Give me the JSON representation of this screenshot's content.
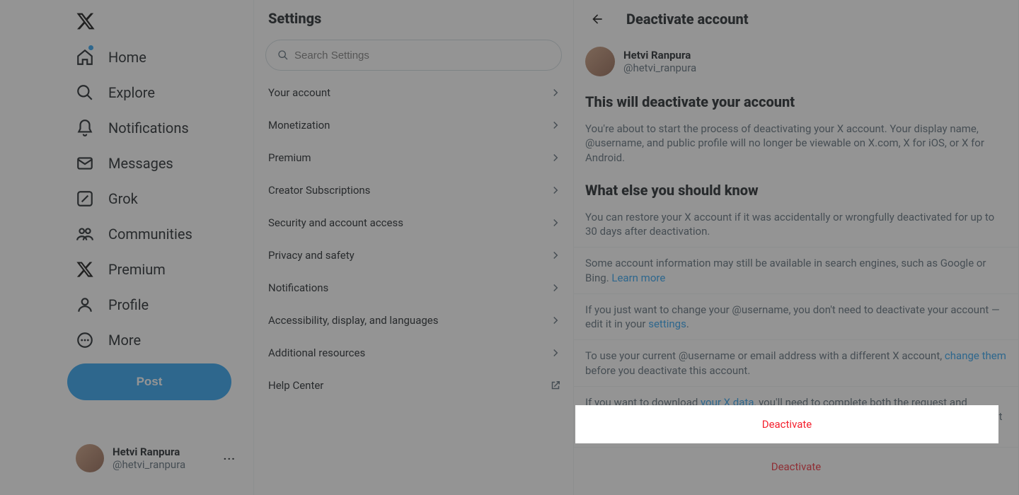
{
  "nav": {
    "home": "Home",
    "explore": "Explore",
    "notifications": "Notifications",
    "messages": "Messages",
    "grok": "Grok",
    "communities": "Communities",
    "premium": "Premium",
    "profile": "Profile",
    "more": "More",
    "post": "Post"
  },
  "account": {
    "name": "Hetvi Ranpura",
    "username": "@hetvi_ranpura"
  },
  "settings": {
    "title": "Settings",
    "search_placeholder": "Search Settings",
    "items": [
      "Your account",
      "Monetization",
      "Premium",
      "Creator Subscriptions",
      "Security and account access",
      "Privacy and safety",
      "Notifications",
      "Accessibility, display, and languages",
      "Additional resources",
      "Help Center"
    ]
  },
  "detail": {
    "title": "Deactivate account",
    "user_name": "Hetvi Ranpura",
    "user_handle": "@hetvi_ranpura",
    "section1_heading": "This will deactivate your account",
    "section1_text": "You're about to start the process of deactivating your X account. Your display name, @username, and public profile will no longer be viewable on X.com, X for iOS, or X for Android.",
    "section2_heading": "What else you should know",
    "info1": "You can restore your X account if it was accidentally or wrongfully deactivated for up to 30 days after deactivation.",
    "info2_pre": "Some account information may still be available in search engines, such as Google or Bing. ",
    "info2_link": "Learn more",
    "info3_pre": "If you just want to change your @username, you don't need to deactivate your account — edit it in your ",
    "info3_link": "settings",
    "info3_post": ".",
    "info4_pre": "To use your current @username or email address with a different X account, ",
    "info4_link": "change them",
    "info4_post": " before you deactivate this account.",
    "info5_pre": "If you want to download ",
    "info5_link": "your X data",
    "info5_post": ", you'll need to complete both the request and download process before deactivating your account. Links to download your data cannot be sent to deactivated accounts.",
    "deactivate_label": "Deactivate"
  }
}
